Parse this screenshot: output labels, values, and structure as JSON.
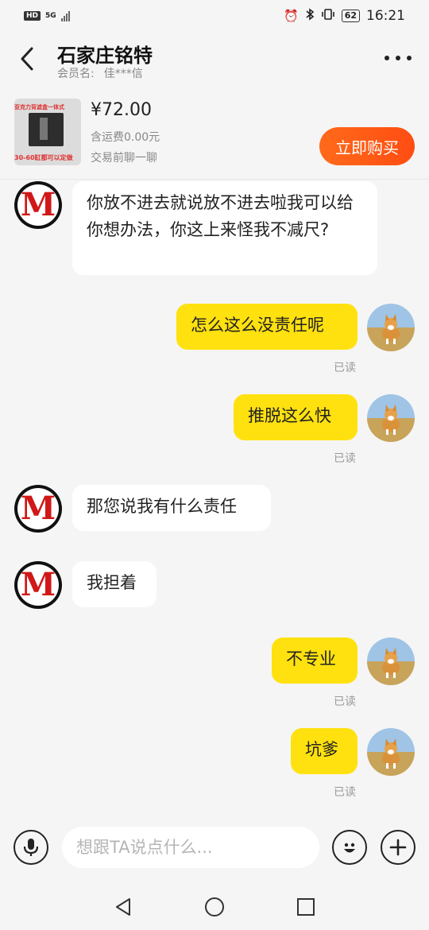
{
  "status_bar": {
    "hd_badge": "HD",
    "network": "5G",
    "battery": "62",
    "time": "16:21"
  },
  "header": {
    "shop_name": "石家庄铭特",
    "member_label": "会员名:",
    "member_name": "佳***信"
  },
  "product": {
    "thumb_top_text": "亚克力背滤盒一体式",
    "thumb_bottom_text": "30-60缸都可以定做",
    "price": "¥72.00",
    "shipping": "含运费0.00元",
    "chat_note": "交易前聊一聊",
    "buy_label": "立即购买"
  },
  "avatars": {
    "seller_letter": "M"
  },
  "messages": [
    {
      "side": "left",
      "text": "你放不进去就说放不进去啦我可以给你想办法，你这上来怪我不减尺?"
    },
    {
      "side": "right",
      "text": "怎么这么没责任呢",
      "status": "已读"
    },
    {
      "side": "right",
      "text": "推脱这么快",
      "status": "已读"
    },
    {
      "side": "left",
      "text": "那您说我有什么责任"
    },
    {
      "side": "left",
      "text": "我担着"
    },
    {
      "side": "right",
      "text": "不专业",
      "status": "已读"
    },
    {
      "side": "right",
      "text": "坑爹",
      "status": "已读"
    }
  ],
  "input": {
    "placeholder": "想跟TA说点什么..."
  },
  "colors": {
    "bubble_mine": "#ffe10f",
    "bubble_theirs": "#ffffff",
    "buy_button": "#ff5318",
    "background": "#f5f5f5"
  },
  "icons": {
    "back": "chevron-left-icon",
    "more": "more-dots-icon",
    "voice": "microphone-icon",
    "emoji": "emoji-icon",
    "plus": "plus-icon",
    "nav_back": "triangle-back-icon",
    "nav_home": "circle-home-icon",
    "nav_recent": "square-recent-icon"
  }
}
